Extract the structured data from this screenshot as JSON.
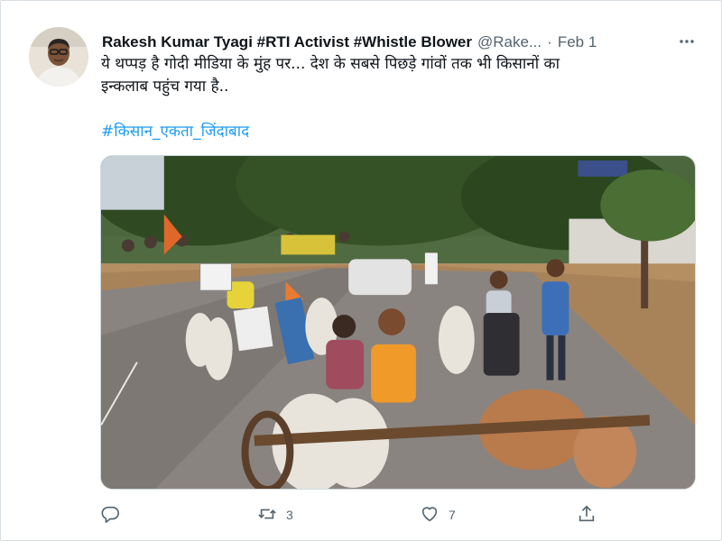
{
  "tweet": {
    "display_name": "Rakesh Kumar Tyagi #RTI Activist #Whistle Blower",
    "handle": "@Rake...",
    "separator": "·",
    "date": "Feb 1",
    "text_line1": "ये थप्पड़ है गोदी मीडिया के मुंह पर... देश के सबसे पिछड़े गांवों तक भी किसानों का",
    "text_line2": "इन्कलाब पहुंच गया है..",
    "hashtag": "#किसान_एकता_जिंदाबाद",
    "more_icon": "more-horizontal-icon"
  },
  "actions": {
    "reply": {
      "icon": "reply-icon",
      "count": ""
    },
    "retweet": {
      "icon": "retweet-icon",
      "count": "3"
    },
    "like": {
      "icon": "heart-icon",
      "count": "7"
    },
    "share": {
      "icon": "share-icon"
    }
  },
  "colors": {
    "accent": "#1d9bf0",
    "muted_text": "#536471",
    "primary_text": "#0f1419",
    "border": "#cfd9de"
  }
}
